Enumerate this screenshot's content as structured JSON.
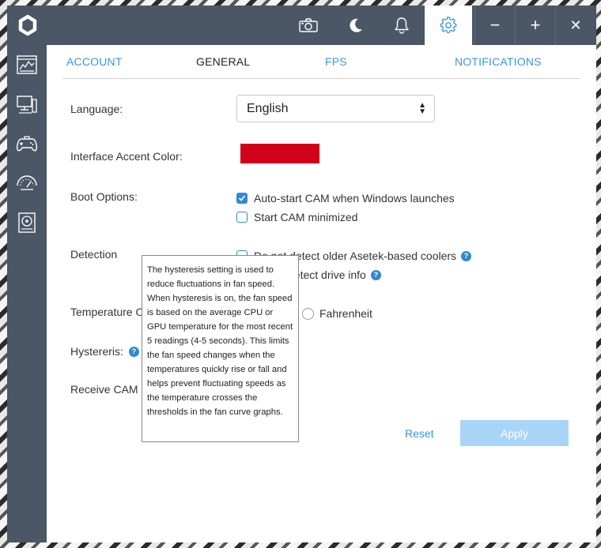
{
  "titlebar": {
    "logo_icon": "cam-logo-icon",
    "buttons": [
      {
        "name": "camera-icon"
      },
      {
        "name": "moon-icon"
      },
      {
        "name": "bell-icon"
      },
      {
        "name": "gear-icon",
        "active": true
      }
    ],
    "window_controls": {
      "minimize": "−",
      "maximize": "+",
      "close": "✕"
    }
  },
  "sidebar": {
    "items": [
      {
        "icon": "dashboard-icon"
      },
      {
        "icon": "pc-monitor-icon"
      },
      {
        "icon": "gamepad-icon"
      },
      {
        "icon": "gauge-icon"
      },
      {
        "icon": "storage-drive-icon"
      }
    ]
  },
  "tabs": [
    {
      "label": "ACCOUNT",
      "active": false
    },
    {
      "label": "GENERAL",
      "active": true
    },
    {
      "label": "FPS",
      "active": false
    },
    {
      "label": "NOTIFICATIONS",
      "active": false
    }
  ],
  "settings": {
    "language_label": "Language:",
    "language_value": "English",
    "accent_label": "Interface Accent Color:",
    "accent_color": "#d0021b",
    "boot_label": "Boot Options:",
    "boot_autostart": "Auto-start CAM when Windows launches",
    "boot_autostart_checked": true,
    "boot_minimized": "Start CAM minimized",
    "boot_minimized_checked": false,
    "detection_label": "Detection",
    "detection_asetek": "Do not detect older Asetek-based coolers",
    "detection_drive": "detect drive info",
    "temperature_label": "Temperature O",
    "fahrenheit_label": "Fahrenheit",
    "hysteresis_label": "Hystereris:",
    "receive_label": "Receive CAM E"
  },
  "actions": {
    "reset": "Reset",
    "apply": "Apply"
  },
  "tooltip": {
    "text": "The hysteresis setting is used to reduce fluctuations in fan speed. When hysteresis is on, the fan speed is based on the average CPU or GPU temperature for the most recent 5 readings (4-5 seconds). This limits the fan speed changes when the temperatures quickly rise or fall and helps prevent fluctuating speeds as the temperature crosses the thresholds in the fan curve graphs."
  },
  "colors": {
    "titlebar": "#4b5667",
    "accent_blue": "#3a96d8",
    "apply_disabled": "#a8d4f8"
  }
}
